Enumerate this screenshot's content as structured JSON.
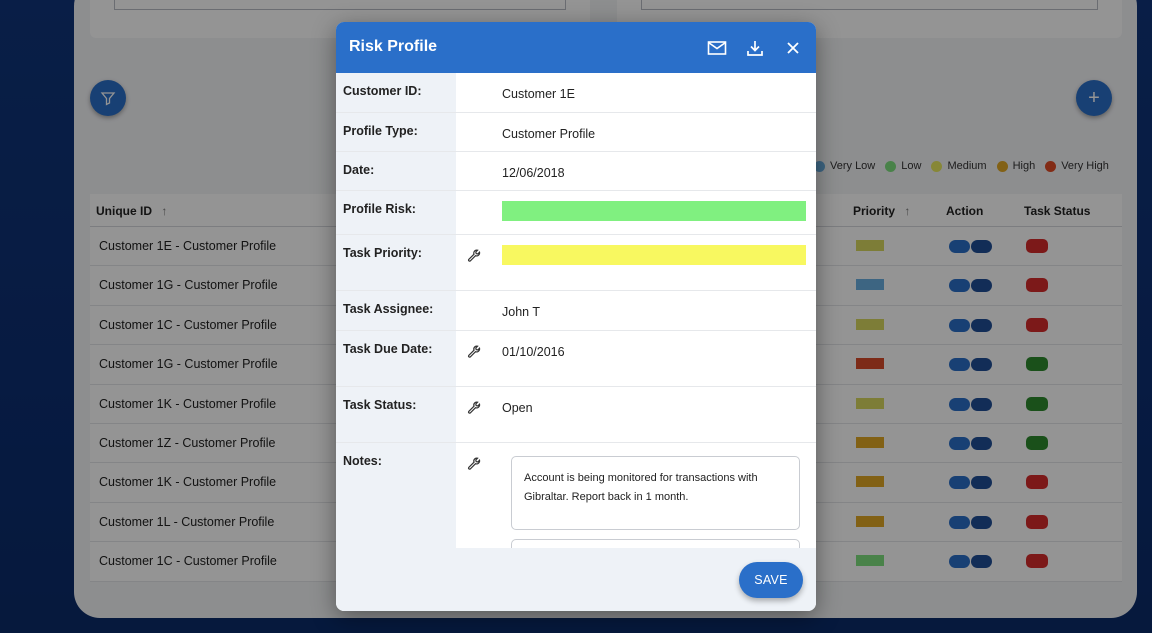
{
  "background_table": {
    "headers": {
      "unique_id": "Unique ID",
      "priority": "Priority",
      "action": "Action",
      "task_status": "Task Status"
    },
    "sort_arrow": "↑",
    "legend": [
      {
        "label": "Very Low",
        "color": "#6aaee0"
      },
      {
        "label": "Low",
        "color": "#7ee07e"
      },
      {
        "label": "Medium",
        "color": "#e8e860"
      },
      {
        "label": "High",
        "color": "#e0a825"
      },
      {
        "label": "Very High",
        "color": "#e04a25"
      }
    ],
    "rows": [
      {
        "id": "Customer 1E - Customer Profile",
        "priority_color": "#d8d860",
        "status_color": "#d62b2b"
      },
      {
        "id": "Customer 1G - Customer Profile",
        "priority_color": "#6aaee0",
        "status_color": "#d62b2b"
      },
      {
        "id": "Customer 1C - Customer Profile",
        "priority_color": "#d8d860",
        "status_color": "#d62b2b"
      },
      {
        "id": "Customer 1G - Customer Profile",
        "priority_color": "#d84a2a",
        "status_color": "#2e8b2e"
      },
      {
        "id": "Customer 1K - Customer Profile",
        "priority_color": "#d8d860",
        "status_color": "#2e8b2e"
      },
      {
        "id": "Customer 1Z - Customer Profile",
        "priority_color": "#e0a825",
        "status_color": "#2e8b2e"
      },
      {
        "id": "Customer 1K - Customer Profile",
        "priority_color": "#e0a825",
        "status_color": "#d62b2b"
      },
      {
        "id": "Customer 1L - Customer Profile",
        "priority_color": "#e0a825",
        "status_color": "#d62b2b"
      },
      {
        "id": "Customer 1C - Customer Profile",
        "priority_color": "#7ee07e",
        "status_color": "#d62b2b"
      }
    ]
  },
  "modal": {
    "title": "Risk Profile",
    "header_icons": [
      "mail-icon",
      "download-icon",
      "close-icon"
    ],
    "fields": {
      "customer_id": {
        "label": "Customer ID:",
        "value": "Customer 1E"
      },
      "profile_type": {
        "label": "Profile Type:",
        "value": "Customer Profile"
      },
      "date": {
        "label": "Date:",
        "value": "12/06/2018"
      },
      "profile_risk": {
        "label": "Profile Risk:",
        "color": "#80f080"
      },
      "task_priority": {
        "label": "Task Priority:",
        "color": "#f8f860"
      },
      "task_assignee": {
        "label": "Task Assignee:",
        "value": "John T"
      },
      "task_due_date": {
        "label": "Task Due Date:",
        "value": "01/10/2016"
      },
      "task_status": {
        "label": "Task Status:",
        "value": "Open"
      },
      "notes": {
        "label": "Notes:",
        "value": "Account is being monitored for transactions with Gibraltar. Report back in 1 month."
      }
    },
    "save_label": "SAVE"
  },
  "colors": {
    "primary": "#2a6fc9"
  }
}
